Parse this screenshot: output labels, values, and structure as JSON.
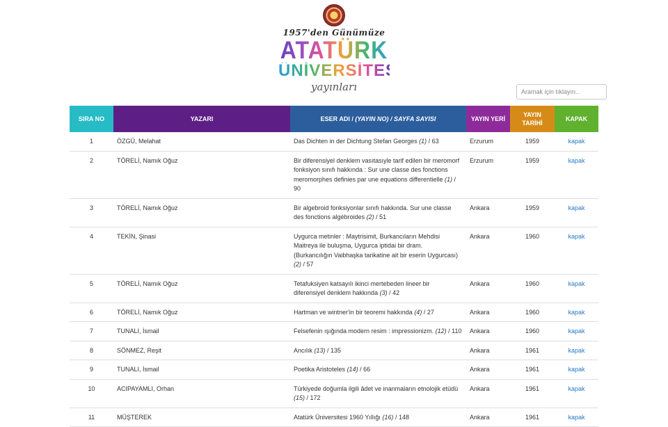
{
  "logo": {
    "since": "1957'den Günümüze",
    "line1": "ATATÜRK",
    "line2": "ÜNİVERSİTESİ",
    "line3": "yayınları"
  },
  "search": {
    "placeholder": "Aramak için tıklayın.."
  },
  "table": {
    "headers": {
      "sira_no": "SIRA NO",
      "yazari": "YAZARI",
      "eser_main": "ESER ADI / ",
      "eser_italic": "(YAYIN NO) / SAYFA SAYISI",
      "yayin_yeri": "YAYIN YERİ",
      "yayin_tarihi": "YAYIN TARİHİ",
      "kapak": "KAPAK"
    },
    "rows": [
      {
        "no": "1",
        "author": "ÖZGÜ, Melahat",
        "title": "Das Dichten in der Dichtung Stefan Georges",
        "vol": "(1)",
        "pages": " / 63",
        "place": "Erzurum",
        "year": "1959",
        "cover": "kapak"
      },
      {
        "no": "2",
        "author": "TÖRELİ, Namık Oğuz",
        "title": "Bir diferensiyel denklem vasıtasıyle tarif edilen bir meromorf fonksiyon sınıfı hakkında : Sur une classe des fonctions meromorphes definies par une equations differentielle",
        "vol": "(1)",
        "pages": " / 90",
        "place": "Erzurum",
        "year": "1959",
        "cover": "kapak"
      },
      {
        "no": "3",
        "author": "TÖRELİ, Namık Oğuz",
        "title": "Bir algebroid fonksiyonlar sınıfı hakkında. Sur une classe des fonctions algébroides",
        "vol": "(2)",
        "pages": " / 51",
        "place": "Ankara",
        "year": "1959",
        "cover": "kapak"
      },
      {
        "no": "4",
        "author": "TEKİN, Şinasi",
        "title": "Uygurca metinler : Maytrisimit, Burkancıların Mehdisi Maitreya ile buluşma, Uygurca iptidai bir dram. (Burkancılığın Vaibhaşka tarikatine ait bir eserin Uygurcası)",
        "vol": "(2)",
        "pages": " / 57",
        "place": "Ankara",
        "year": "1960",
        "cover": "kapak"
      },
      {
        "no": "5",
        "author": "TÖRELİ, Namık Oğuz",
        "title": "Tetafuksiyen katsayılı ikinci mertebeden lineer bir diferensiyel denklem hakkında",
        "vol": "(3)",
        "pages": " / 42",
        "place": "Ankara",
        "year": "1960",
        "cover": "kapak"
      },
      {
        "no": "6",
        "author": "TÖRELİ, Namık Oğuz",
        "title": "Hartman ve wintner'in bir teoremi hakkında",
        "vol": "(4)",
        "pages": " / 27",
        "place": "Ankara",
        "year": "1960",
        "cover": "kapak"
      },
      {
        "no": "7",
        "author": "TUNALI, İsmail",
        "title": "Felsefenin ışığında modern resim : impressionizm.",
        "vol": "(12)",
        "pages": " / 110",
        "place": "Ankara",
        "year": "1960",
        "cover": "kapak"
      },
      {
        "no": "8",
        "author": "SÖNMEZ, Reşit",
        "title": "Ancılık",
        "vol": "(13)",
        "pages": " / 135",
        "place": "Ankara",
        "year": "1961",
        "cover": "kapak"
      },
      {
        "no": "9",
        "author": "TUNALI, İsmail",
        "title": "Poetika Aristoteles",
        "vol": "(14)",
        "pages": " / 66",
        "place": "Ankara",
        "year": "1961",
        "cover": "kapak"
      },
      {
        "no": "10",
        "author": "ACIPAYAMLI, Orhan",
        "title": "Türkiyede doğumla ilgili âdet ve inanmaların etnolojik etüdü",
        "vol": "(15)",
        "pages": " / 172",
        "place": "Ankara",
        "year": "1961",
        "cover": "kapak"
      },
      {
        "no": "11",
        "author": "MÜŞTEREK",
        "title": "Atatürk Üniversitesi 1960 Yıllığı",
        "vol": "(16)",
        "pages": " / 148",
        "place": "Ankara",
        "year": "1961",
        "cover": "kapak"
      }
    ]
  },
  "colors": {
    "sira_no": "#27bcc5",
    "yazari": "#5d1f86",
    "eser": "#2c5e9e",
    "yayin_yeri": "#8e2b9b",
    "yayin_tarihi": "#d68b18",
    "kapak": "#5fb12e",
    "link": "#2a7ac6"
  }
}
